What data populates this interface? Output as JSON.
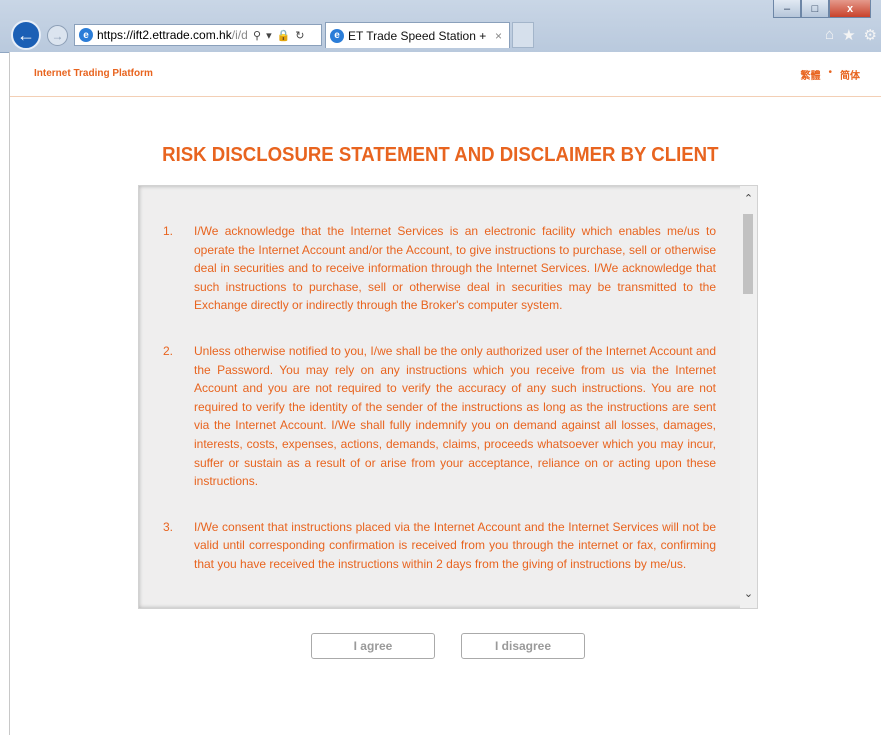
{
  "browser": {
    "url_host": "https://ift2.ettrade.com.hk",
    "url_rest": "/i/d",
    "tab_title": "ET Trade Speed Station +",
    "tab_close": "×",
    "window_min": "–",
    "window_max": "□",
    "window_close": "x",
    "icons": [
      "back-arrow-icon",
      "forward-arrow-icon",
      "ie-logo-icon",
      "search-icon",
      "lock-icon",
      "refresh-icon",
      "home-icon",
      "favorites-star-icon",
      "settings-gear-icon"
    ]
  },
  "header": {
    "platform_title": "Internet Trading Platform",
    "lang_traditional": "繁體",
    "lang_separator": "•",
    "lang_simplified": "简体"
  },
  "main": {
    "heading": "RISK DISCLOSURE STATEMENT AND DISCLAIMER BY CLIENT",
    "clauses": [
      {
        "num": "1.",
        "text": "I/We acknowledge that the Internet Services is an electronic facility which enables me/us to operate the Internet Account and/or the Account, to give instructions to purchase, sell or otherwise deal in securities and to receive information through the Internet Services. I/We acknowledge that such instructions to purchase, sell or otherwise deal in securities may be transmitted to the Exchange directly or indirectly through the Broker's computer system."
      },
      {
        "num": "2.",
        "text": "Unless otherwise notified to you, I/we shall be the only authorized user of the Internet Account and the Password. You may rely on any instructions which you receive from us via the Internet Account and you are not required to verify the accuracy of any such instructions. You are not required to verify the identity of the sender of the instructions as long as the instructions are sent via the Internet Account. I/We shall fully indemnify you on demand against all losses, damages, interests, costs, expenses, actions, demands, claims, proceeds whatsoever which you may incur, suffer or sustain as a result of or arise from your acceptance, reliance on or acting upon these instructions."
      },
      {
        "num": "3.",
        "text": "I/We consent that instructions placed via the Internet Account and the Internet Services will not be valid until corresponding confirmation is received from you through the internet or fax, confirming that you have received the instructions within 2 days from the giving of instructions by me/us."
      }
    ],
    "agree_label": "I agree",
    "disagree_label": "I disagree"
  },
  "colors": {
    "accent": "#e8641f",
    "box_background": "#efeeee",
    "button_text": "#9a9a9a"
  }
}
